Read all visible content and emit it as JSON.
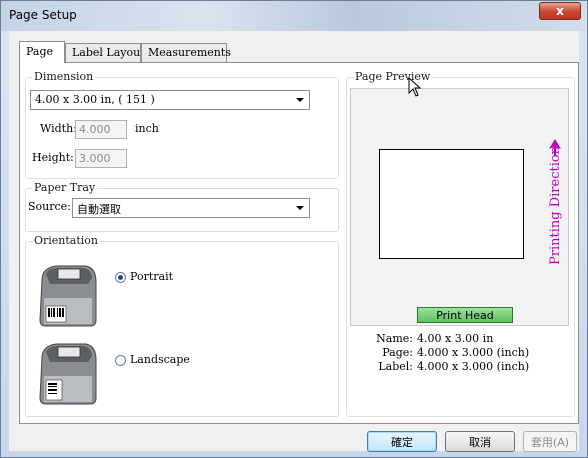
{
  "window": {
    "title": "Page Setup",
    "close_label": "x"
  },
  "tabs": [
    {
      "label": "Page",
      "active": true
    },
    {
      "label": "Label Layout",
      "active": false
    },
    {
      "label": "Measurements",
      "active": false
    }
  ],
  "dimension": {
    "title": "Dimension",
    "selected": "4.00 x 3.00 in, ( 151 )",
    "width_label": "Width:",
    "width_value": "4.000",
    "unit": "inch",
    "height_label": "Height:",
    "height_value": "3.000"
  },
  "paper_tray": {
    "title": "Paper Tray",
    "source_label": "Source:",
    "source_value": "自動選取"
  },
  "orientation": {
    "title": "Orientation",
    "portrait_label": "Portrait",
    "landscape_label": "Landscape",
    "selected": "Portrait"
  },
  "preview": {
    "title": "Page Preview",
    "print_head_label": "Print Head",
    "direction_label": "Printing Direction",
    "name_label": "Name:",
    "name_value": "4.00 x 3.00 in",
    "page_label": "Page:",
    "page_value": "4.000 x 3.000 (inch)",
    "label_label": "Label:",
    "label_value": "4.000 x 3.000 (inch)"
  },
  "buttons": {
    "ok": "確定",
    "cancel": "取消",
    "apply": "套用(A)"
  },
  "colors": {
    "direction": "#c000c0",
    "print_head": "#5fbf5f",
    "close_button": "#c8452d"
  }
}
